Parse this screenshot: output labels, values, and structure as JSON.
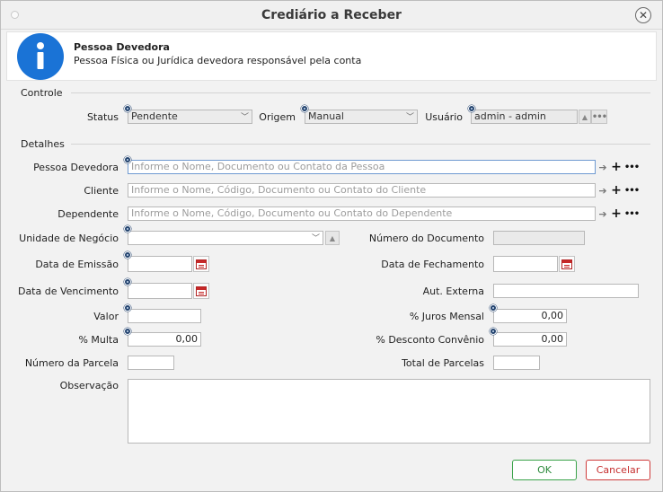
{
  "window": {
    "title": "Crediário a Receber"
  },
  "info": {
    "title": "Pessoa Devedora",
    "description": "Pessoa Física ou Jurídica devedora responsável pela conta"
  },
  "sections": {
    "controle": "Controle",
    "detalhes": "Detalhes"
  },
  "controle": {
    "status_label": "Status",
    "status_value": "Pendente",
    "origem_label": "Origem",
    "origem_value": "Manual",
    "usuario_label": "Usuário",
    "usuario_value": "admin - admin"
  },
  "detalhes": {
    "pessoa_label": "Pessoa Devedora",
    "pessoa_placeholder": "Informe o Nome, Documento ou Contato da Pessoa",
    "cliente_label": "Cliente",
    "cliente_placeholder": "Informe o Nome, Código, Documento ou Contato do Cliente",
    "dependente_label": "Dependente",
    "dependente_placeholder": "Informe o Nome, Código, Documento ou Contato do Dependente",
    "unidade_label": "Unidade de Negócio",
    "numero_documento_label": "Número do Documento",
    "data_emissao_label": "Data de Emissão",
    "data_fechamento_label": "Data de Fechamento",
    "data_vencimento_label": "Data de Vencimento",
    "aut_externa_label": "Aut. Externa",
    "valor_label": "Valor",
    "juros_label": "% Juros Mensal",
    "juros_value": "0,00",
    "multa_label": "% Multa",
    "multa_value": "0,00",
    "desconto_label": "% Desconto Convênio",
    "desconto_value": "0,00",
    "numero_parcela_label": "Número da Parcela",
    "total_parcelas_label": "Total de Parcelas",
    "observacao_label": "Observação"
  },
  "icons": {
    "dots": "•••",
    "plus": "+",
    "arrow": "➔",
    "up": "▲",
    "chevron": "﹀",
    "close": "✕"
  },
  "buttons": {
    "ok": "OK",
    "cancel": "Cancelar"
  },
  "colors": {
    "accent": "#1a73d6",
    "ok": "#2e8b3d",
    "cancel": "#c62e2e",
    "required": "#23436e"
  }
}
